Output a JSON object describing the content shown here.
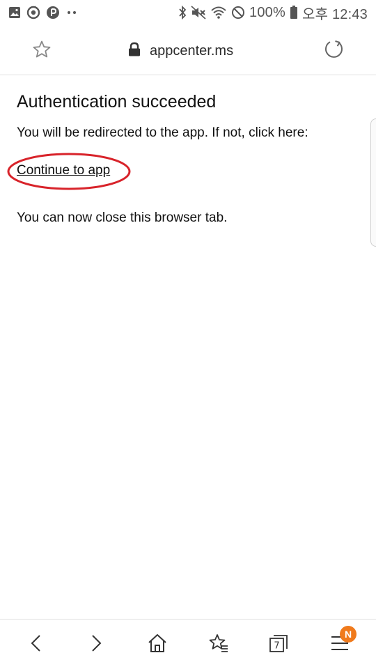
{
  "status_bar": {
    "battery_text": "100%",
    "time_text": "오후 12:43",
    "left_icons": [
      "gallery-icon",
      "sync-icon",
      "pay-icon",
      "more-dots-icon"
    ],
    "right_icons": [
      "bluetooth-icon",
      "mute-icon",
      "wifi-icon",
      "blocked-icon",
      "battery-icon"
    ]
  },
  "browser": {
    "url": "appcenter.ms",
    "url_icon": "lock-icon",
    "bookmark_icon": "star-icon",
    "reload_icon": "reload-icon"
  },
  "page": {
    "title": "Authentication succeeded",
    "redirect_message": "You will be redirected to the app. If not, click here:",
    "continue_link": "Continue to app",
    "close_message": "You can now close this browser tab."
  },
  "bottom_nav": {
    "items": [
      {
        "name": "back",
        "icon": "back-arrow-icon"
      },
      {
        "name": "forward",
        "icon": "forward-arrow-icon"
      },
      {
        "name": "home",
        "icon": "home-icon"
      },
      {
        "name": "bookmarks",
        "icon": "bookmarks-icon"
      },
      {
        "name": "tabs",
        "icon": "tabs-icon"
      },
      {
        "name": "menu",
        "icon": "menu-icon"
      }
    ],
    "tab_count": "7",
    "menu_badge": "N"
  },
  "colors": {
    "annotation_circle": "#d8232a",
    "badge": "#f07a1c"
  }
}
